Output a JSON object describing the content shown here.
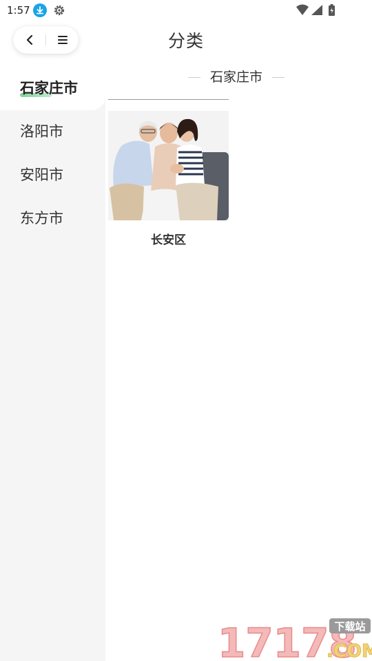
{
  "status_bar": {
    "time": "1:57"
  },
  "header": {
    "title": "分类"
  },
  "sidebar": {
    "items": [
      {
        "label": "石家庄市",
        "active": true
      },
      {
        "label": "洛阳市",
        "active": false
      },
      {
        "label": "安阳市",
        "active": false
      },
      {
        "label": "东方市",
        "active": false
      }
    ]
  },
  "content": {
    "section_title": "石家庄市",
    "cards": [
      {
        "title": "长安区",
        "image": "family-photo"
      }
    ]
  },
  "watermark": {
    "number": "17178",
    "tag": "下载站",
    "suffix": ".COM"
  },
  "colors": {
    "accent_underline": "#6ec98a",
    "sidebar_bg": "#f5f5f5",
    "download_icon": "#1aa3e8"
  }
}
